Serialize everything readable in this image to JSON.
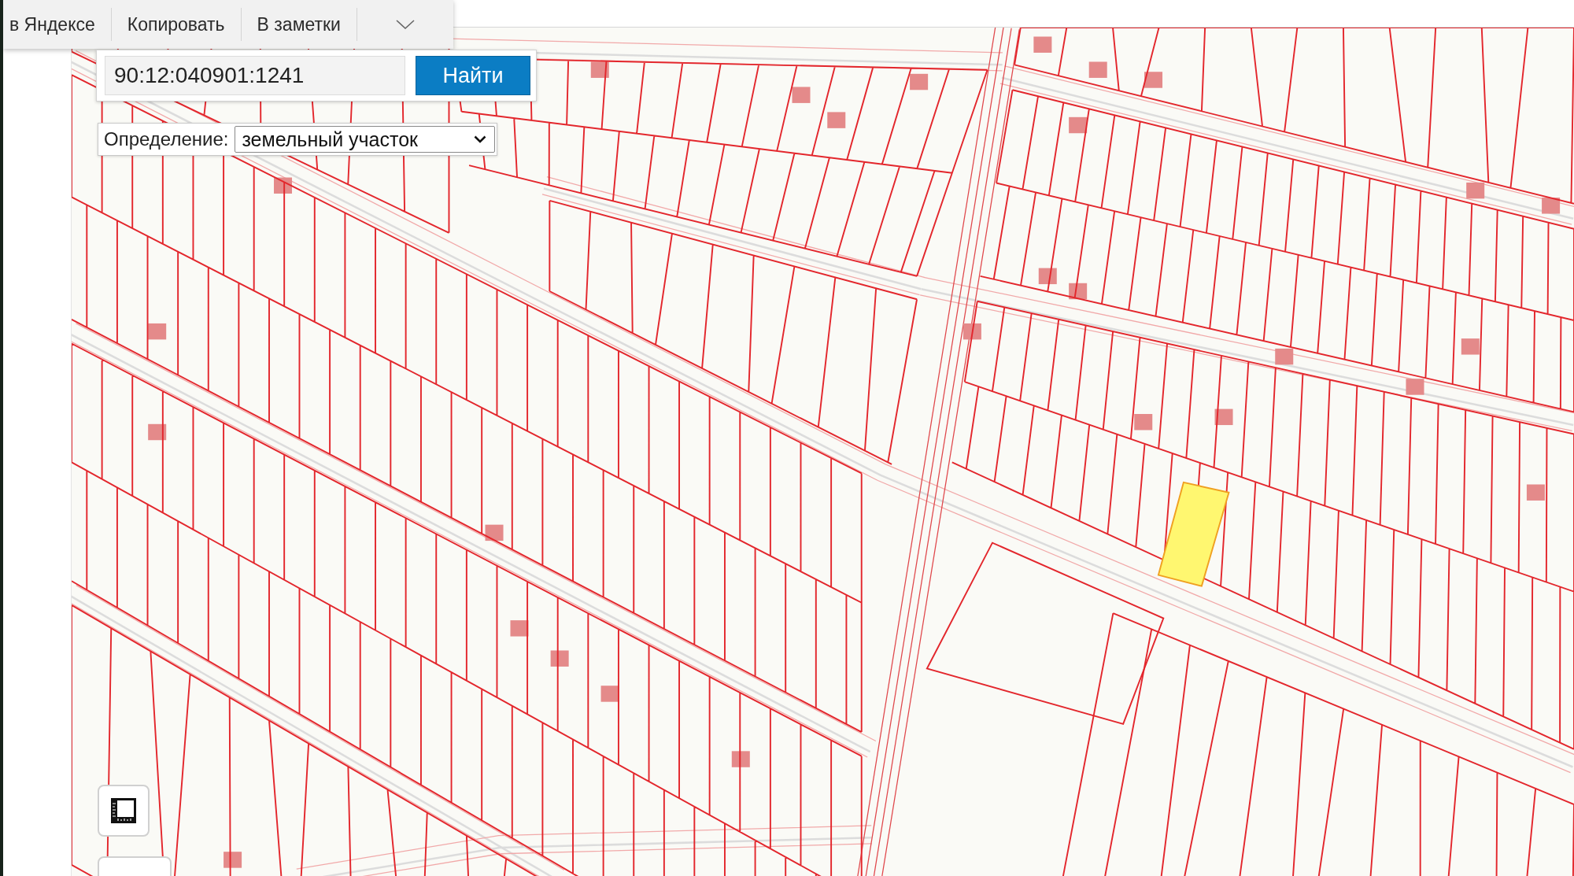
{
  "context_menu": {
    "items": [
      {
        "label": "в Яндексе"
      },
      {
        "label": "Копировать"
      },
      {
        "label": "В заметки"
      }
    ]
  },
  "search": {
    "value": "90:12:040901:1241",
    "button": "Найти"
  },
  "definition": {
    "label": "Определение:",
    "value": "земельный участок"
  }
}
